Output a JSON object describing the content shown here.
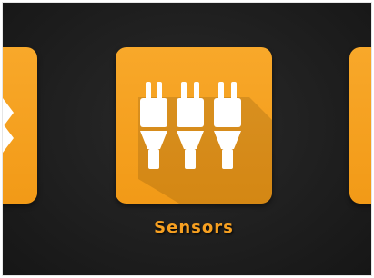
{
  "carousel": {
    "selected_label": "Sensors",
    "items": [
      {
        "icon": "partial-arrow-icon"
      },
      {
        "icon": "sensors-icon",
        "label": "Sensors"
      },
      {
        "icon": "partial-circle-icon"
      }
    ]
  },
  "colors": {
    "background": "#1f1f1f",
    "tile": "#f6a323",
    "label": "#f7a021",
    "glyph": "#ffffff"
  }
}
